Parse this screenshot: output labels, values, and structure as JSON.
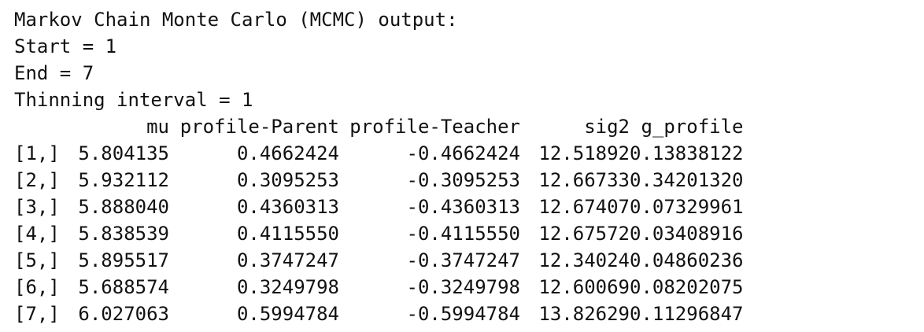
{
  "header": {
    "title_line": "Markov Chain Monte Carlo (MCMC) output:",
    "start_line": "Start = 1",
    "end_line": "End = 7",
    "thinning_line": "Thinning interval = 1"
  },
  "table": {
    "columns": [
      "",
      "mu",
      "profile-Parent",
      "profile-Teacher",
      "sig2",
      "g_profile"
    ],
    "rows": [
      {
        "label": "[1,]",
        "values": [
          "5.804135",
          "0.4662424",
          "-0.4662424",
          "12.51892",
          "0.13838122"
        ]
      },
      {
        "label": "[2,]",
        "values": [
          "5.932112",
          "0.3095253",
          "-0.3095253",
          "12.66733",
          "0.34201320"
        ]
      },
      {
        "label": "[3,]",
        "values": [
          "5.888040",
          "0.4360313",
          "-0.4360313",
          "12.67407",
          "0.07329961"
        ]
      },
      {
        "label": "[4,]",
        "values": [
          "5.838539",
          "0.4115550",
          "-0.4115550",
          "12.67572",
          "0.03408916"
        ]
      },
      {
        "label": "[5,]",
        "values": [
          "5.895517",
          "0.3747247",
          "-0.3747247",
          "12.34024",
          "0.04860236"
        ]
      },
      {
        "label": "[6,]",
        "values": [
          "5.688574",
          "0.3249798",
          "-0.3249798",
          "12.60069",
          "0.08202075"
        ]
      },
      {
        "label": "[7,]",
        "values": [
          "6.027063",
          "0.5994784",
          "-0.5994784",
          "13.82629",
          "0.11296847"
        ]
      }
    ]
  }
}
